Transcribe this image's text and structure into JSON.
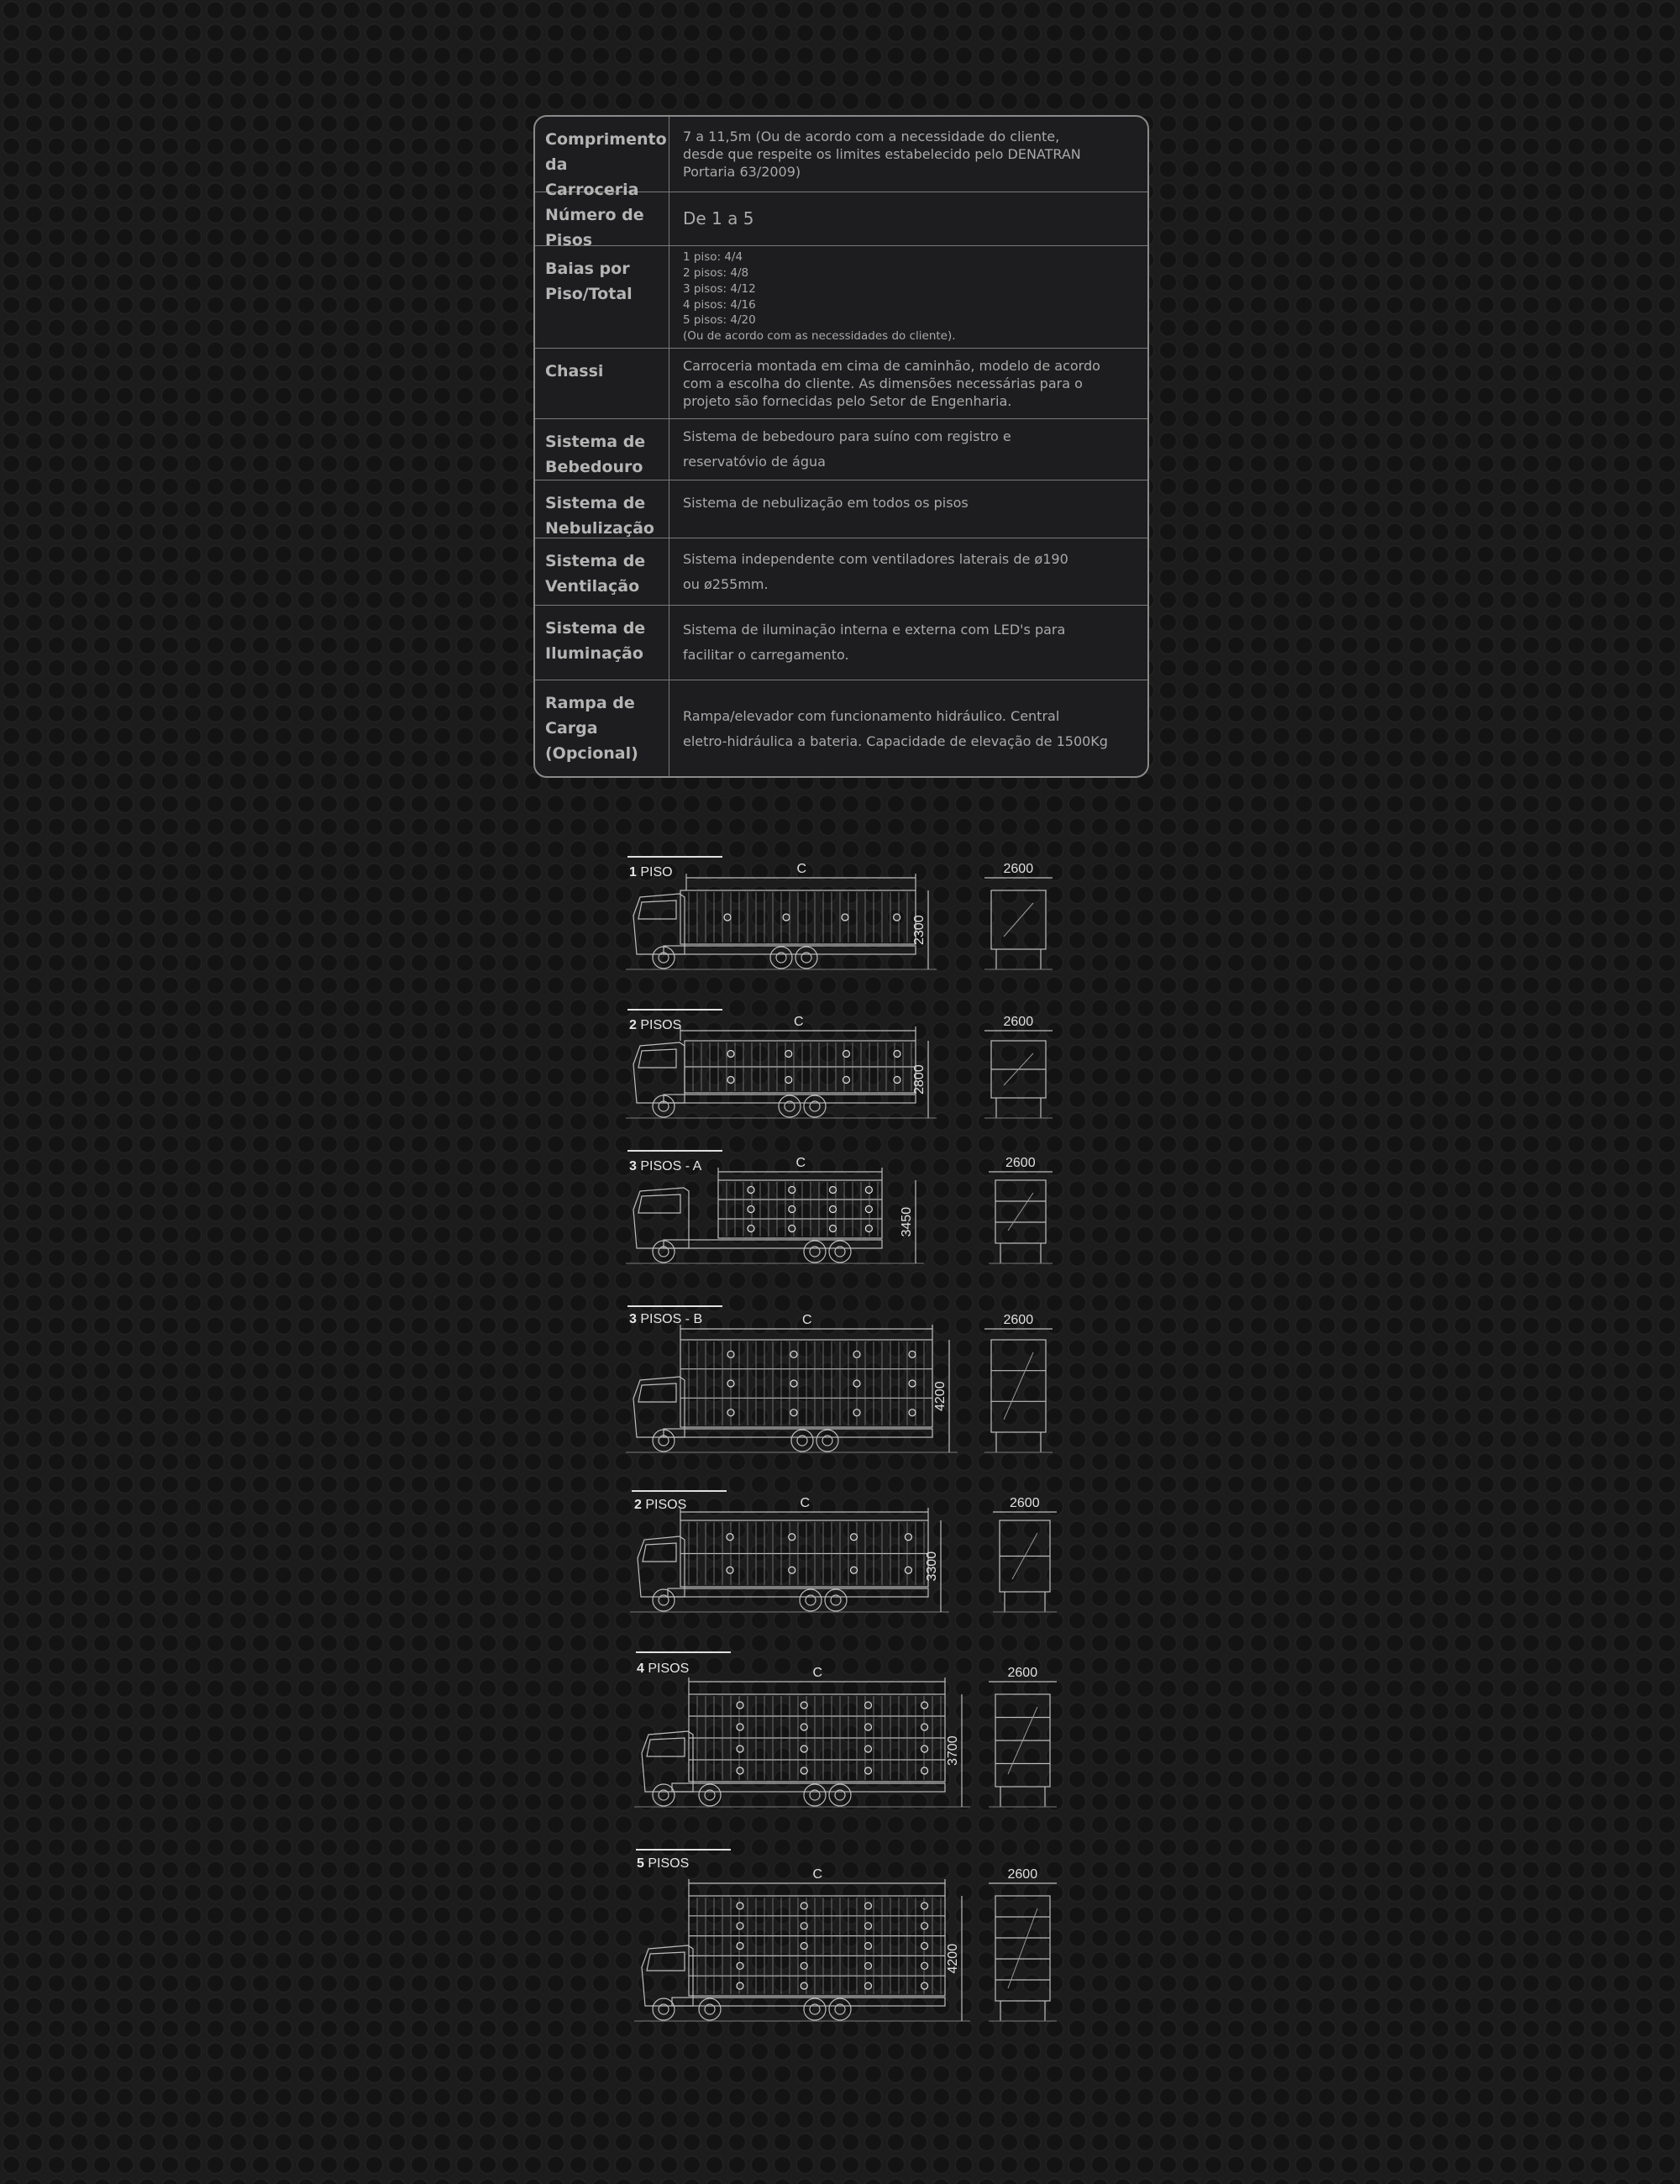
{
  "specs": {
    "rows": [
      {
        "label": "Comprimento da Carroceria",
        "lines": [
          "7 a 11,5m (Ou de acordo com a necessidade do cliente,",
          "desde que respeite os limites estabelecido pelo DENATRAN",
          "Portaria 63/2009)"
        ]
      },
      {
        "label": "Número de Pisos",
        "lines": [
          "De 1 a 5"
        ]
      },
      {
        "label": "Baias por Piso/Total",
        "lines": [
          "1 piso: 4/4",
          "2 pisos: 4/8",
          "3 pisos: 4/12",
          "4 pisos: 4/16",
          "5 pisos: 4/20",
          "(Ou de acordo com as necessidades do cliente)."
        ]
      },
      {
        "label": "Chassi",
        "lines": [
          "Carroceria montada em cima de caminhão, modelo de acordo",
          "com a escolha do cliente. As dimensões necessárias para o",
          "projeto são fornecidas pelo Setor de Engenharia."
        ]
      },
      {
        "label": "Sistema de Bebedouro",
        "lines": [
          "Sistema de bebedouro para  suíno com registro e",
          "reservatóvio de água"
        ]
      },
      {
        "label": "Sistema de Nebulização",
        "lines": [
          "Sistema de nebulização em todos os pisos"
        ]
      },
      {
        "label": "Sistema de Ventilação",
        "lines": [
          "Sistema independente com ventiladores laterais de ø190",
          "ou ø255mm."
        ]
      },
      {
        "label": "Sistema de Iluminação",
        "lines": [
          "Sistema de iluminação interna e externa com LED's para",
          "facilitar o carregamento."
        ]
      },
      {
        "label": "Rampa de Carga (Opcional)",
        "lines": [
          "Rampa/elevador com funcionamento hidráulico. Central",
          "eletro-hidráulica a bateria. Capacidade de elevação de 1500Kg"
        ]
      }
    ]
  },
  "diagrams": [
    {
      "number": "1",
      "suffix": " PISO",
      "length_label": "C",
      "height_label": "2300",
      "width_label": "2600",
      "floors": 1
    },
    {
      "number": "2",
      "suffix": " PISOS",
      "length_label": "C",
      "height_label": "2800",
      "width_label": "2600",
      "floors": 2
    },
    {
      "number": "3",
      "suffix": " PISOS - A",
      "length_label": "C",
      "height_label": "3450",
      "width_label": "2600",
      "floors": 3
    },
    {
      "number": "3",
      "suffix": " PISOS - B",
      "length_label": "C",
      "height_label": "4200",
      "width_label": "2600",
      "floors": 3
    },
    {
      "number": "2",
      "suffix": " PISOS",
      "length_label": "C",
      "height_label": "3300",
      "width_label": "2600",
      "floors": 2
    },
    {
      "number": "4",
      "suffix": " PISOS",
      "length_label": "C",
      "height_label": "3700",
      "width_label": "2600",
      "floors": 4
    },
    {
      "number": "5",
      "suffix": " PISOS",
      "length_label": "C",
      "height_label": "4200",
      "width_label": "2600",
      "floors": 5
    }
  ]
}
